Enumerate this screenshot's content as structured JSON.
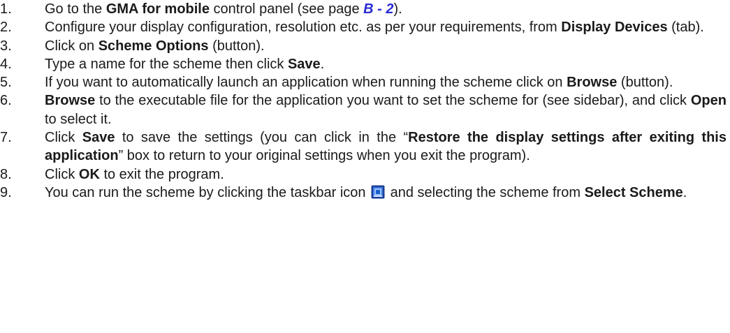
{
  "steps": [
    {
      "number": "1.",
      "parts": [
        {
          "t": "Go to the "
        },
        {
          "t": "GMA for mobile",
          "b": true
        },
        {
          "t": " control panel (see page "
        },
        {
          "t": "B - 2",
          "ref": true
        },
        {
          "t": ")."
        }
      ]
    },
    {
      "number": "2.",
      "parts": [
        {
          "t": "Configure your display configuration, resolution etc. as per your requirements, from "
        },
        {
          "t": "Display Devices",
          "b": true
        },
        {
          "t": " (tab)."
        }
      ]
    },
    {
      "number": "3.",
      "parts": [
        {
          "t": "Click on "
        },
        {
          "t": "Scheme Options",
          "b": true
        },
        {
          "t": " (button)."
        }
      ]
    },
    {
      "number": "4.",
      "parts": [
        {
          "t": "Type a name for the scheme then click "
        },
        {
          "t": "Save",
          "b": true
        },
        {
          "t": "."
        }
      ]
    },
    {
      "number": "5.",
      "parts": [
        {
          "t": "If you want to automatically launch an application when running the scheme click on "
        },
        {
          "t": "Browse",
          "b": true
        },
        {
          "t": " (button)."
        }
      ]
    },
    {
      "number": "6.",
      "parts": [
        {
          "t": "Browse",
          "b": true
        },
        {
          "t": " to the executable file for the application you want to set the scheme for (see sidebar), and click "
        },
        {
          "t": "Open",
          "b": true
        },
        {
          "t": " to select it."
        }
      ]
    },
    {
      "number": "7.",
      "parts": [
        {
          "t": "Click "
        },
        {
          "t": "Save",
          "b": true
        },
        {
          "t": " to save the settings (you can click in the “"
        },
        {
          "t": "Restore the display settings after exiting this application",
          "b": true
        },
        {
          "t": "” box to return to your original settings when you exit the program)."
        }
      ]
    },
    {
      "number": "8.",
      "parts": [
        {
          "t": "Click "
        },
        {
          "t": "OK",
          "b": true
        },
        {
          "t": " to exit the program."
        }
      ]
    },
    {
      "number": "9.",
      "parts": [
        {
          "t": "You can run the scheme by clicking the taskbar icon "
        },
        {
          "icon": "taskbar-scheme-icon"
        },
        {
          "t": " and selecting the scheme from "
        },
        {
          "t": "Select Scheme",
          "b": true
        },
        {
          "t": "."
        }
      ]
    }
  ],
  "colors": {
    "text": "#1a1a1a",
    "page_reference": "#2b2bd4",
    "icon_frame": "#1e3f9a",
    "icon_fill": "#3f7de0"
  }
}
